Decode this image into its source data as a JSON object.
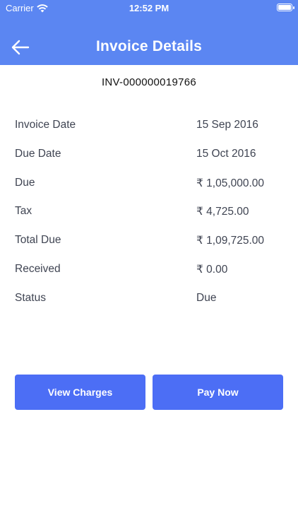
{
  "status_bar": {
    "carrier": "Carrier",
    "time": "12:52 PM",
    "icons": [
      "wifi-icon",
      "battery-icon"
    ]
  },
  "nav": {
    "back_icon": "back-arrow-icon",
    "title": "Invoice Details"
  },
  "invoice_number": "INV-000000019766",
  "details": [
    {
      "label": "Invoice Date",
      "value": "15 Sep 2016"
    },
    {
      "label": "Due Date",
      "value": "15 Oct 2016"
    },
    {
      "label": "Due",
      "value": "₹ 1,05,000.00"
    },
    {
      "label": "Tax",
      "value": "₹ 4,725.00"
    },
    {
      "label": "Total Due",
      "value": "₹ 1,09,725.00"
    },
    {
      "label": "Received",
      "value": "₹ 0.00"
    },
    {
      "label": "Status",
      "value": "Due"
    }
  ],
  "actions": {
    "view_charges_label": "View Charges",
    "pay_now_label": "Pay Now"
  },
  "colors": {
    "header_bg": "#5b86f2",
    "button_bg": "#4c6ef5"
  }
}
